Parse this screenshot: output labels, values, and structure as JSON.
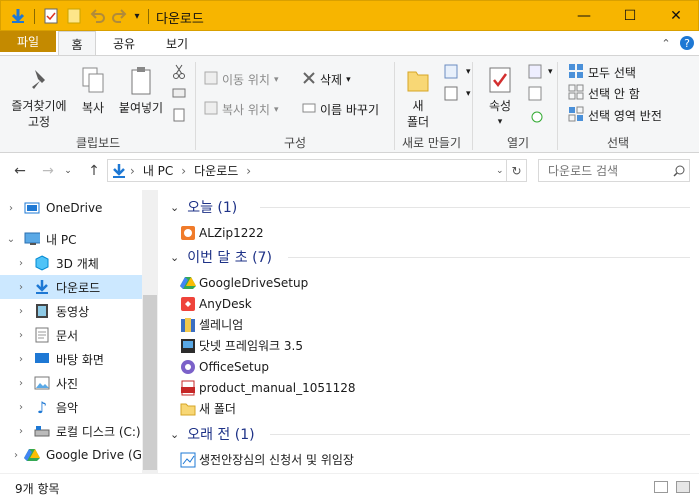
{
  "window": {
    "title": "다운로드",
    "controls": {
      "minimize": "—",
      "maximize": "☐",
      "close": "✕"
    }
  },
  "ribbon_tabs": [
    "파일",
    "홈",
    "공유",
    "보기"
  ],
  "ribbon": {
    "clipboard": {
      "pin": "즐겨찾기에\n고정",
      "copy": "복사",
      "paste": "붙여넣기",
      "label": "클립보드"
    },
    "organize": {
      "move_to": "이동 위치",
      "copy_to": "복사 위치",
      "delete": "삭제",
      "rename": "이름 바꾸기",
      "label": "구성"
    },
    "new": {
      "new_folder": "새\n폴더",
      "label": "새로 만들기"
    },
    "open": {
      "properties": "속성",
      "label": "열기"
    },
    "select": {
      "select_all": "모두 선택",
      "select_none": "선택 안 함",
      "invert": "선택 영역 반전",
      "label": "선택"
    }
  },
  "address": {
    "root": "내 PC",
    "current": "다운로드",
    "sep": "›"
  },
  "search": {
    "placeholder": "다운로드 검색"
  },
  "nav_items": [
    {
      "label": "OneDrive",
      "icon": "cloud-icon"
    },
    {
      "label": "내 PC",
      "icon": "computer-icon"
    },
    {
      "label": "3D 개체",
      "icon": "cube-icon"
    },
    {
      "label": "다운로드",
      "icon": "download-icon"
    },
    {
      "label": "동영상",
      "icon": "video-icon"
    },
    {
      "label": "문서",
      "icon": "document-icon"
    },
    {
      "label": "바탕 화면",
      "icon": "desktop-icon"
    },
    {
      "label": "사진",
      "icon": "picture-icon"
    },
    {
      "label": "음악",
      "icon": "music-icon"
    },
    {
      "label": "로컬 디스크 (C:)",
      "icon": "drive-icon"
    },
    {
      "label": "Google Drive (G:",
      "icon": "google-drive-icon"
    }
  ],
  "groups": [
    {
      "title": "오늘 (1)",
      "files": [
        {
          "name": "ALZip1222",
          "icon": "alzip-icon"
        }
      ]
    },
    {
      "title": "이번 달 초 (7)",
      "files": [
        {
          "name": "GoogleDriveSetup",
          "icon": "google-drive-icon"
        },
        {
          "name": "AnyDesk",
          "icon": "anydesk-icon"
        },
        {
          "name": "셀레니엄",
          "icon": "archive-icon"
        },
        {
          "name": "닷넷 프레임워크 3.5",
          "icon": "installer-icon"
        },
        {
          "name": "OfficeSetup",
          "icon": "office-icon"
        },
        {
          "name": "product_manual_1051128",
          "icon": "pdf-icon"
        },
        {
          "name": "새 폴더",
          "icon": "folder-icon"
        }
      ]
    },
    {
      "title": "오래 전 (1)",
      "files": [
        {
          "name": "생전안장심의 신청서 및 위임장",
          "icon": "document-icon"
        }
      ]
    }
  ],
  "status": {
    "count": "9개 항목"
  },
  "colors": {
    "titlebar": "#f7b500",
    "file_tab": "#c48a00",
    "selection": "#cce8ff",
    "group_text": "#1e3287",
    "accent_blue": "#1e78d4"
  }
}
